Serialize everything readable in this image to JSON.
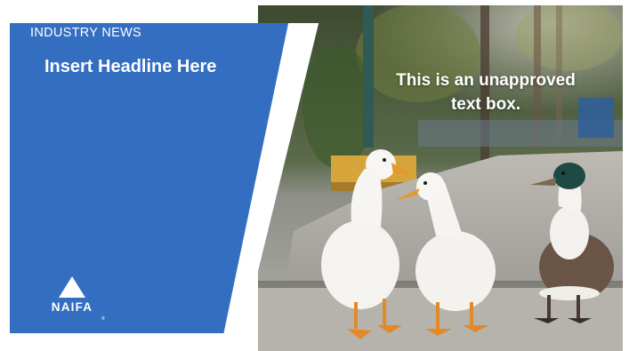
{
  "slide": {
    "category": "INDUSTRY NEWS",
    "headline": "Insert Headline Here",
    "overlay_line1": "This is an unapproved",
    "overlay_line2": "text box."
  },
  "logo": {
    "name": "NAIFA",
    "reg_mark": "®"
  },
  "colors": {
    "panel_blue": "#336ec1",
    "text": "#ffffff",
    "frame": "#ffffff"
  },
  "icons": {
    "logo_mark": "triangle-icon",
    "photo": "ducks-photo"
  }
}
